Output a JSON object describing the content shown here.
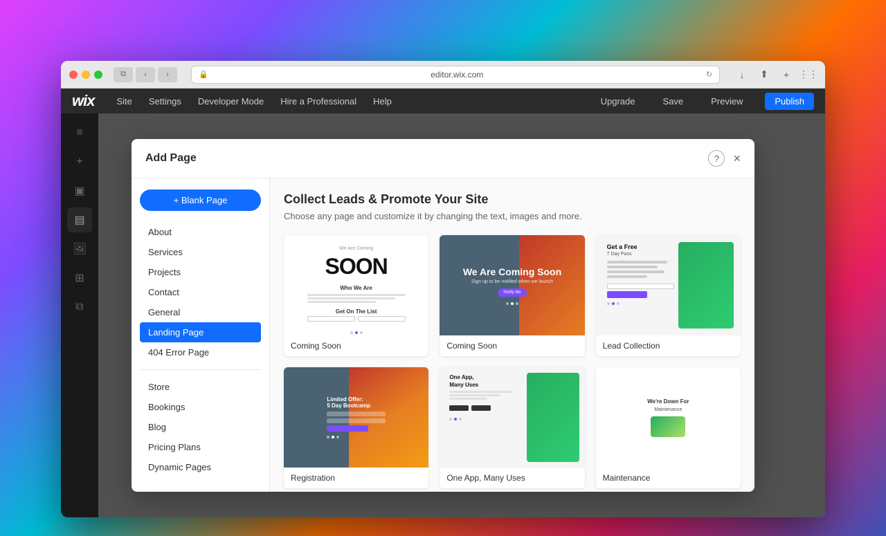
{
  "browser": {
    "traffic_lights": [
      "red",
      "yellow",
      "green"
    ],
    "address": "editor.wix.com",
    "back_btn": "‹",
    "forward_btn": "›",
    "tab_icon": "⧉"
  },
  "wix_topbar": {
    "logo": "Wix",
    "nav_items": [
      "Site",
      "Settings",
      "Developer Mode",
      "Hire a Professional",
      "Help"
    ],
    "right_items": [
      "Upgrade",
      "Save",
      "Preview"
    ],
    "publish_label": "Publish"
  },
  "modal": {
    "title": "Add Page",
    "help_label": "?",
    "close_label": "×",
    "blank_page_btn": "+ Blank Page",
    "nav_sections": {
      "pages": [
        "About",
        "Services",
        "Projects",
        "Contact",
        "General",
        "Landing Page",
        "404 Error Page"
      ],
      "store_items": [
        "Store",
        "Bookings",
        "Blog",
        "Pricing Plans",
        "Dynamic Pages"
      ],
      "active_item": "Landing Page"
    },
    "content": {
      "title": "Collect Leads & Promote Your Site",
      "subtitle": "Choose any page and customize it by changing the text, images and more.",
      "templates": [
        {
          "id": "coming-soon-1",
          "label": "Coming Soon",
          "type": "soon-1"
        },
        {
          "id": "coming-soon-2",
          "label": "Coming Soon",
          "type": "soon-2"
        },
        {
          "id": "lead-collection",
          "label": "Lead Collection",
          "type": "lead"
        },
        {
          "id": "registration",
          "label": "Registration",
          "type": "reg"
        },
        {
          "id": "app-mobile",
          "label": "One App, Many Uses",
          "type": "app"
        },
        {
          "id": "maintenance",
          "label": "Maintenance",
          "type": "maintenance"
        }
      ]
    }
  },
  "soon1": {
    "top_text": "We Are Coming",
    "big_text": "SOON",
    "who_text": "Who We Are",
    "get_on_text": "Get On The List"
  },
  "soon2": {
    "main_text": "We Are Coming Soon",
    "sub_text": "Sign up to be notified when we launch",
    "btn_text": "Notify Me"
  },
  "lead": {
    "title": "Get a Free",
    "sub": "7 Day Pass"
  },
  "reg": {
    "title": "Limited Offer:",
    "sub": "5 Day Bootcamp"
  },
  "app": {
    "title": "One App,",
    "sub": "Many Uses"
  },
  "maintenance": {
    "title": "We're Down For",
    "sub": "Maintenance"
  }
}
